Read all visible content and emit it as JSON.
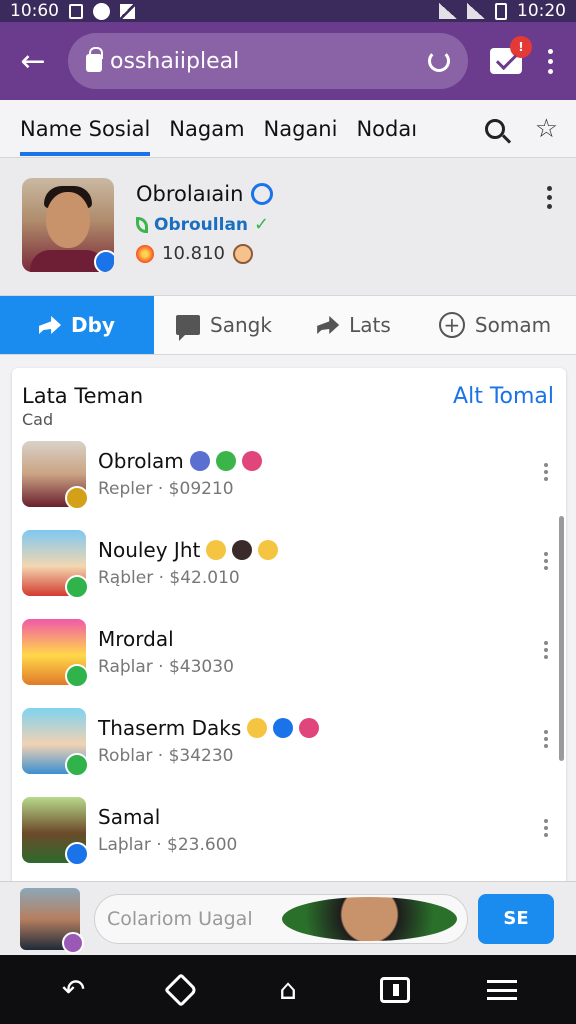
{
  "status_bar": {
    "time_left": "10:60",
    "time_right": "10:20"
  },
  "app_bar": {
    "url": "osshaiipleal",
    "notif_badge": "!"
  },
  "tabs": [
    {
      "label": "Name Sosial",
      "active": true
    },
    {
      "label": "Nagam",
      "active": false
    },
    {
      "label": "Nagani",
      "active": false
    },
    {
      "label": "Nodaı",
      "active": false
    }
  ],
  "profile": {
    "name": "Obrolaıain",
    "subtitle": "Obroullan",
    "stat": "10.810"
  },
  "actions": [
    {
      "label": "Dby",
      "icon": "share-icon",
      "active": true
    },
    {
      "label": "Sangk",
      "icon": "comment-icon",
      "active": false
    },
    {
      "label": "Lats",
      "icon": "forward-icon",
      "active": false
    },
    {
      "label": "Somam",
      "icon": "plus-circle-icon",
      "active": false
    }
  ],
  "friends": {
    "title": "Lata Teman",
    "subtitle": "Cad",
    "link": "Alt Tomal",
    "items": [
      {
        "name": "Obrolam",
        "meta": "Repler · $09210",
        "badge_color": "#d4a017",
        "bg": "linear-gradient(180deg,#d9d2c7 0%,#caa384 50%,#6a1f2e 100%)",
        "emojis": [
          "#5b6fd1",
          "#3bb54a",
          "#e0457b"
        ]
      },
      {
        "name": "Nouley Jht",
        "meta": "Rąbler · $42.010",
        "badge_color": "#2fb34a",
        "bg": "linear-gradient(180deg,#7ec8f2 0%,#f3d6b0 55%,#d23b2f 100%)",
        "emojis": [
          "#f5c542",
          "#3b2a2a",
          "#f5c542"
        ]
      },
      {
        "name": "Mrordal",
        "meta": "Raþlar · $43030",
        "badge_color": "#2fb34a",
        "bg": "linear-gradient(180deg,#f05aa8 0%,#ffd84a 55%,#e07a2a 100%)",
        "emojis": []
      },
      {
        "name": "Thaserm Daks",
        "meta": "Roblar · $34230",
        "badge_color": "#2fb34a",
        "bg": "linear-gradient(180deg,#7fd3f0 0%,#f2d2b3 55%,#3b8fd0 100%)",
        "emojis": [
          "#f5c542",
          "#1a73e8",
          "#e0457b"
        ]
      },
      {
        "name": "Samal",
        "meta": "Laþlar · $23.600",
        "badge_color": "#1a73e8",
        "bg": "linear-gradient(180deg,#b8d98b 0%,#6b4a2a 55%,#2d6a2d 100%)",
        "emojis": []
      }
    ]
  },
  "composer": {
    "placeholder": "Colariom Uagal",
    "send_label": "SE"
  }
}
